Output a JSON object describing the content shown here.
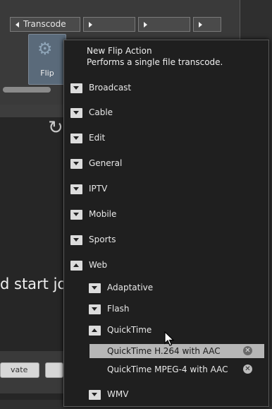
{
  "toolbar": {
    "tab_label": "Transcode",
    "flip_label": "Flip"
  },
  "background": {
    "start_text": "d start jo",
    "activate_label": "vate"
  },
  "menu": {
    "title": "New Flip Action",
    "subtitle": "Performs a single file transcode.",
    "categories": [
      {
        "label": "Broadcast",
        "expanded": false
      },
      {
        "label": "Cable",
        "expanded": false
      },
      {
        "label": "Edit",
        "expanded": false
      },
      {
        "label": "General",
        "expanded": false
      },
      {
        "label": "IPTV",
        "expanded": false
      },
      {
        "label": "Mobile",
        "expanded": false
      },
      {
        "label": "Sports",
        "expanded": false
      },
      {
        "label": "Web",
        "expanded": true
      }
    ],
    "web_children": [
      {
        "label": "Adaptative",
        "expanded": false
      },
      {
        "label": "Flash",
        "expanded": false
      },
      {
        "label": "QuickTime",
        "expanded": true
      }
    ],
    "quicktime_children": [
      {
        "label": "QuickTime H.264 with AAC",
        "selected": true
      },
      {
        "label": "QuickTime MPEG-4 with AAC",
        "selected": false
      }
    ],
    "wmv_label": "WMV",
    "remove_glyph": "✕"
  }
}
